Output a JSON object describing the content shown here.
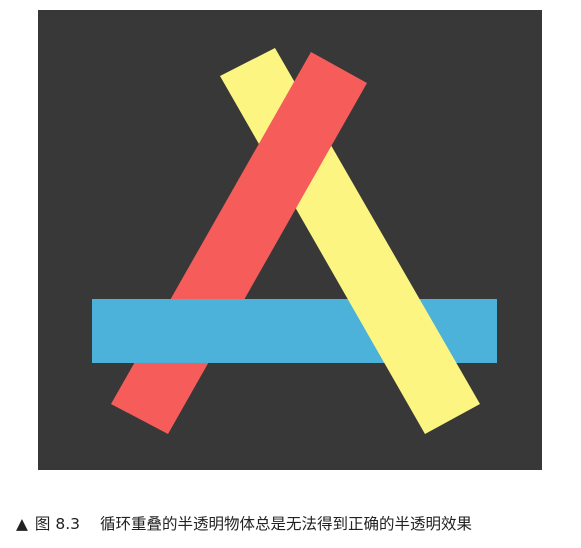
{
  "figure": {
    "background_color": "#383838",
    "shapes": [
      {
        "name": "yellow-bar",
        "color": "#FCF582"
      },
      {
        "name": "red-bar",
        "color": "#F65D5A"
      },
      {
        "name": "blue-bar",
        "color": "#4DB2D9"
      }
    ]
  },
  "caption": {
    "marker": "▲",
    "label": "图 8.3",
    "text": "循环重叠的半透明物体总是无法得到正确的半透明效果"
  }
}
